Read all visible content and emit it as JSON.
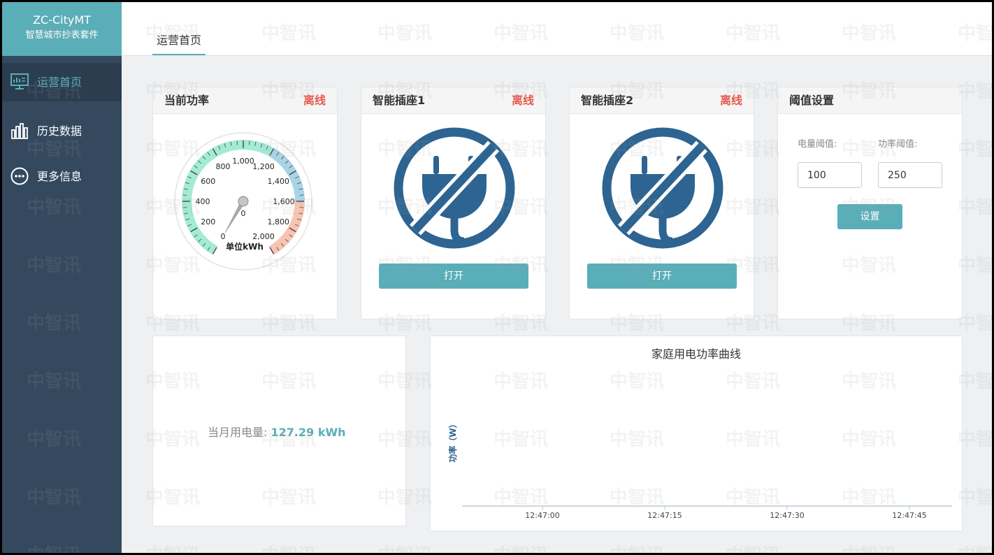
{
  "brand": {
    "name": "ZC-CityMT",
    "subtitle": "智慧城市抄表套件"
  },
  "sidebar": {
    "items": [
      {
        "label": "运营首页",
        "icon": "monitor-icon",
        "active": true
      },
      {
        "label": "历史数据",
        "icon": "bar-chart-icon",
        "active": false
      },
      {
        "label": "更多信息",
        "icon": "more-circle-icon",
        "active": false
      }
    ]
  },
  "header": {
    "tab": "运营首页"
  },
  "cards": {
    "power": {
      "title": "当前功率",
      "status": "离线",
      "gauge": {
        "value": 0,
        "min": 0,
        "max": 2000,
        "unit_label": "单位kWh",
        "tick_labels": [
          "0",
          "200",
          "400",
          "600",
          "800",
          "1,000",
          "1,200",
          "1,400",
          "1,600",
          "1,800",
          "2,000"
        ]
      }
    },
    "socket1": {
      "title": "智能插座1",
      "status": "离线",
      "button": "打开",
      "icon": "plug-disabled-icon"
    },
    "socket2": {
      "title": "智能插座2",
      "status": "离线",
      "button": "打开",
      "icon": "plug-disabled-icon"
    },
    "threshold": {
      "title": "阈值设置",
      "energy_label": "电量阈值:",
      "energy_value": "100",
      "power_label": "功率阈值:",
      "power_value": "250",
      "button": "设置"
    },
    "usage": {
      "label": "当月用电量:",
      "value": "127.29 kWh"
    }
  },
  "chart_data": {
    "type": "line",
    "title": "家庭用电功率曲线",
    "ylabel": "功率（W）",
    "x_ticks": [
      "12:47:00",
      "12:47:15",
      "12:47:30",
      "12:47:45"
    ],
    "series": []
  },
  "colors": {
    "accent": "#5aaeb8",
    "sidebar": "#34495e",
    "offline": "#e65a50",
    "icon_blue": "#2d6491"
  },
  "watermark": "中智讯"
}
